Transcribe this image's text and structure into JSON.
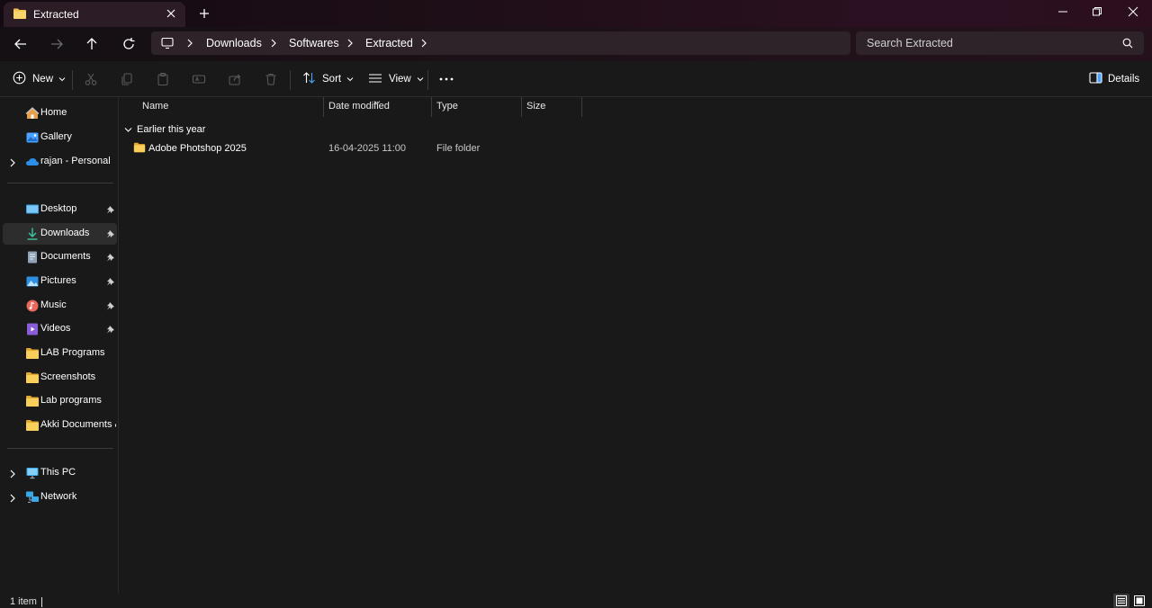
{
  "tab": {
    "title": "Extracted"
  },
  "breadcrumb": [
    "Downloads",
    "Softwares",
    "Extracted"
  ],
  "search": {
    "placeholder": "Search Extracted"
  },
  "commands": {
    "new_label": "New",
    "sort_label": "Sort",
    "view_label": "View",
    "details_label": "Details"
  },
  "sidebar": {
    "top": [
      {
        "label": "Home",
        "icon": "home-icon"
      },
      {
        "label": "Gallery",
        "icon": "gallery-icon"
      },
      {
        "label": "rajan - Personal",
        "icon": "onedrive-cloud-icon",
        "expandable": true
      }
    ],
    "quick_access": [
      {
        "label": "Desktop",
        "icon": "desktop-icon",
        "pinned": true
      },
      {
        "label": "Downloads",
        "icon": "downloads-icon",
        "pinned": true,
        "selected": true
      },
      {
        "label": "Documents",
        "icon": "documents-icon",
        "pinned": true
      },
      {
        "label": "Pictures",
        "icon": "pictures-icon",
        "pinned": true
      },
      {
        "label": "Music",
        "icon": "music-icon",
        "pinned": true
      },
      {
        "label": "Videos",
        "icon": "videos-icon",
        "pinned": true
      },
      {
        "label": "LAB Programs",
        "icon": "folder-icon"
      },
      {
        "label": "Screenshots",
        "icon": "folder-icon"
      },
      {
        "label": "Lab programs",
        "icon": "folder-icon"
      },
      {
        "label": "Akki Documents &",
        "icon": "folder-icon"
      }
    ],
    "bottom": [
      {
        "label": "This PC",
        "icon": "this-pc-icon",
        "expandable": true
      },
      {
        "label": "Network",
        "icon": "network-icon",
        "expandable": true
      }
    ]
  },
  "columns": [
    "Name",
    "Date modified",
    "Type",
    "Size"
  ],
  "group": {
    "label": "Earlier this year"
  },
  "files": [
    {
      "name": "Adobe Photshop 2025",
      "date_modified": "16-04-2025 11:00",
      "type": "File folder",
      "size": ""
    }
  ],
  "status": {
    "item_count": "1 item"
  },
  "colors": {
    "background": "#191919",
    "folder_yellow": "#f2c14e",
    "selected_bg": "#2d2d2d",
    "address_bg": "#2d2328"
  }
}
